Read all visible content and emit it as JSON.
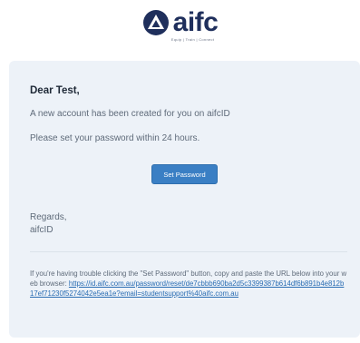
{
  "header": {
    "logo_text": "aifc",
    "logo_tagline": "Equip | Train | Connect",
    "colors": {
      "brand_navy": "#1f2f5c"
    }
  },
  "email": {
    "greeting": "Dear Test,",
    "line_1": "A new account has been created for you on aifcID",
    "line_2": "Please set your password within 24 hours.",
    "button_label": "Set Password",
    "regards": "Regards,",
    "signature": "aifcID",
    "help_text": "If you're having trouble clicking the \"Set Password\" button, copy and paste the URL below into your web browser: ",
    "reset_url": "https://id.aifc.com.au/password/reset/de7cbbb690ba2d5c3399387b614df6b891b4e812b17ef71230f5274042e5ea1e?email=studentsupport%40aifc.com.au",
    "colors": {
      "card_background": "#edf2f8",
      "button": "#3a7fc4",
      "link": "#2a6db3"
    }
  }
}
